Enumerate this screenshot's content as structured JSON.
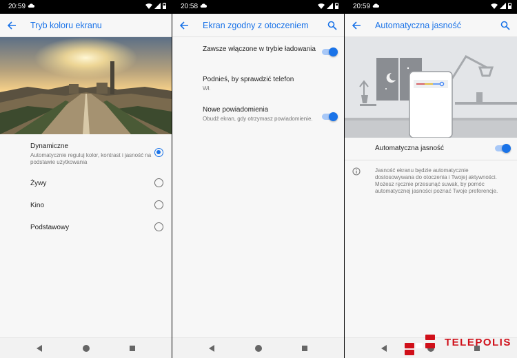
{
  "screens": [
    {
      "status_time": "20:59",
      "title": "Tryb koloru ekranu",
      "options": [
        {
          "label": "Dynamiczne",
          "sublabel": "Automatycznie reguluj kolor, kontrast i jasność na podstawie użytkowania",
          "selected": true
        },
        {
          "label": "Żywy",
          "selected": false
        },
        {
          "label": "Kino",
          "selected": false
        },
        {
          "label": "Podstawowy",
          "selected": false
        }
      ]
    },
    {
      "status_time": "20:58",
      "title": "Ekran zgodny z otoczeniem",
      "items": [
        {
          "label": "Zawsze włączone w trybie ładowania",
          "toggle": true
        },
        {
          "label": "Podnieś, by sprawdzić telefon",
          "sublabel": "Wł."
        },
        {
          "label": "Nowe powiadomienia",
          "sublabel": "Obudź ekran, gdy otrzymasz powiadomienie.",
          "toggle": true
        }
      ]
    },
    {
      "status_time": "20:59",
      "title": "Automatyczna jasność",
      "setting_label": "Automatyczna jasność",
      "setting_on": true,
      "info_text": "Jasność ekranu będzie automatycznie dostosowywana do otoczenia i Twojej aktywności. Możesz ręcznie przesunąć suwak, by pomóc automatycznej jasności poznać Twoje preferencje."
    }
  ],
  "watermark": {
    "text": "TELEPOLIS"
  },
  "colors": {
    "accent": "#1a73e8",
    "logo": "#d0101a"
  }
}
